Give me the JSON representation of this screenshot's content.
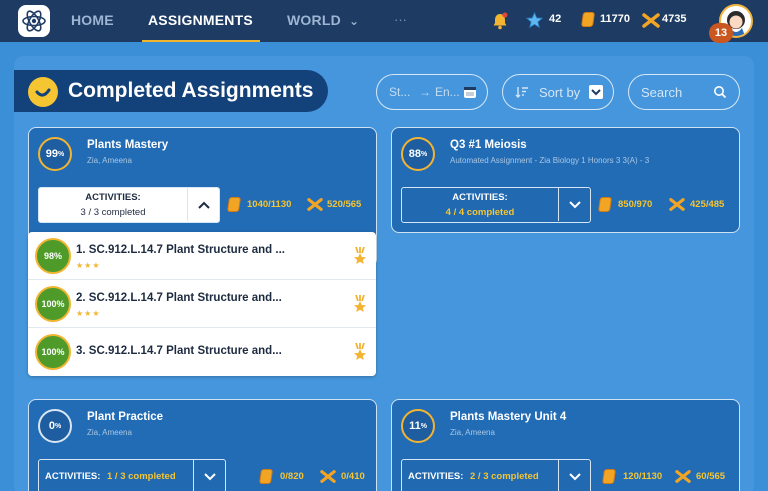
{
  "nav": {
    "items": [
      "HOME",
      "ASSIGNMENTS",
      "WORLD"
    ],
    "world_chevron": "⌄",
    "more": "···"
  },
  "stats": {
    "stars": "42",
    "coins": "11770",
    "xp": "4735",
    "level": "13"
  },
  "header": {
    "title": "Completed Assignments",
    "date_start_placeholder": "St...",
    "date_arrow": "→",
    "date_end_placeholder": "En...",
    "sort_label": "Sort by",
    "search_placeholder": "Search"
  },
  "cards": [
    {
      "percent": "99",
      "title": "Plants Mastery",
      "subtitle": "Zia, Ameena",
      "activities_label": "ACTIVITIES:",
      "activities_value": "3 / 3 completed",
      "coins": "1040/1130",
      "xp": "520/565",
      "expanded": true,
      "toggle": "⌃"
    },
    {
      "percent": "88",
      "title": "Q3 #1 Meiosis",
      "subtitle": "Automated Assignment - Zia Biology 1 Honors 3 3(A) - 3",
      "activities_label": "ACTIVITIES:",
      "activities_value": "4 / 4 completed",
      "coins": "850/970",
      "xp": "425/485",
      "expanded": false,
      "toggle": "⌄"
    },
    {
      "percent": "0",
      "title": "Plant Practice",
      "subtitle": "Zia, Ameena",
      "activities_label": "ACTIVITIES:",
      "activities_value": "1 / 3 completed",
      "coins": "0/820",
      "xp": "0/410",
      "expanded": false,
      "toggle": "⌄"
    },
    {
      "percent": "11",
      "title": "Plants Mastery Unit 4",
      "subtitle": "Zia, Ameena",
      "activities_label": "ACTIVITIES:",
      "activities_value": "2 / 3 completed",
      "coins": "120/1130",
      "xp": "60/565",
      "expanded": false,
      "toggle": "⌄"
    }
  ],
  "activities": [
    {
      "percent": "98",
      "title": "1. SC.912.L.14.7 Plant Structure and ...",
      "stars": "★★★"
    },
    {
      "percent": "100",
      "title": "2. SC.912.L.14.7 Plant Structure and...",
      "stars": "★★★"
    },
    {
      "percent": "100",
      "title": "3. SC.912.L.14.7 Plant Structure and...",
      "stars": ""
    }
  ],
  "percent_sign": "%",
  "colors": {
    "nav_bg": "#1d3b63",
    "page_bg": "#3b8fd6",
    "card_bg": "#226cb5",
    "accent_gold": "#f2b431",
    "badge_green": "#4f9b2a"
  },
  "icons": [
    "atom-logo-icon",
    "bell-icon",
    "star-icon",
    "coin-icon",
    "xp-icon",
    "avatar-icon",
    "check-icon",
    "calendar-icon",
    "sort-icon",
    "search-icon",
    "medal-icon"
  ]
}
